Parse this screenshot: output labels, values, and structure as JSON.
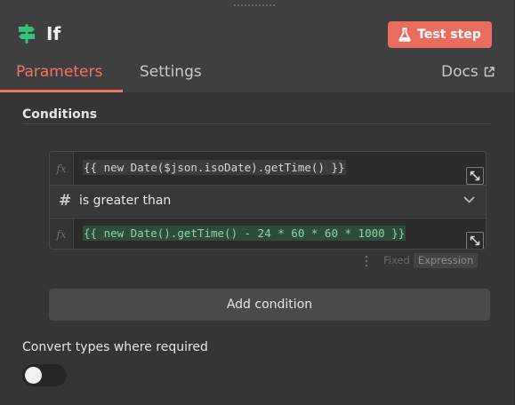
{
  "node": {
    "icon": "signpost-icon",
    "title": "If",
    "test_step_label": "Test step"
  },
  "tabs": {
    "parameters": "Parameters",
    "settings": "Settings",
    "docs": "Docs"
  },
  "conditions": {
    "heading": "Conditions",
    "fx_label": "fx",
    "left_value": "{{ new Date($json.isoDate).getTime() }}",
    "operator_icon": "#",
    "operator": "is greater than",
    "right_value": "{{ new Date().getTime() - 24 * 60 * 60 * 1000 }}",
    "mode_fixed": "Fixed",
    "mode_expression": "Expression",
    "add_condition_label": "Add condition"
  },
  "options": {
    "convert_types_label": "Convert types where required",
    "convert_types_enabled": false
  },
  "colors": {
    "accent": "#ea6c5f",
    "node_icon": "#35c176",
    "expression_green": "#8fd4a6"
  }
}
